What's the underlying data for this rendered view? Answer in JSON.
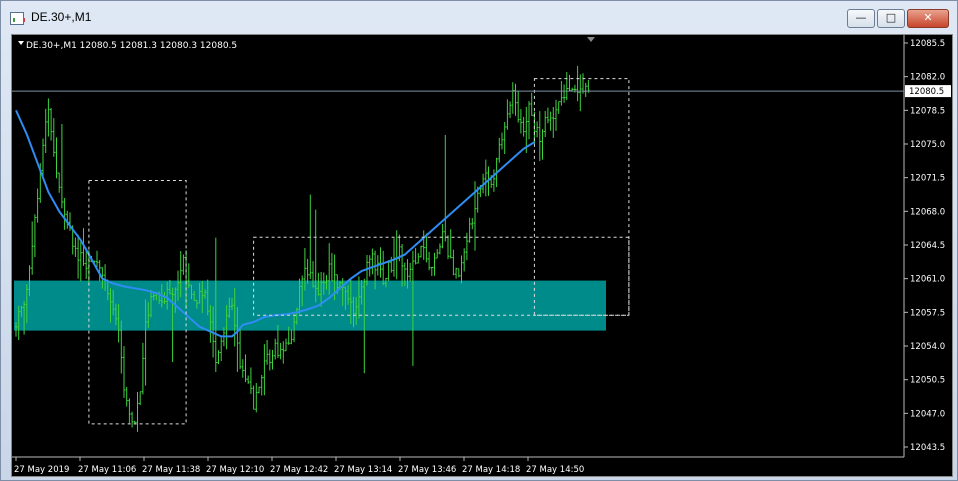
{
  "window": {
    "title": "DE.30+,M1",
    "minimize_glyph": "—",
    "maximize_glyph": "□",
    "close_glyph": "✕"
  },
  "chart_data": {
    "type": "candlestick",
    "symbol_header": "DE.30+,M1  12080.5 12081.3 12080.3 12080.5",
    "last_price_label": "12080.5",
    "last_price": 12080.5,
    "y_ticks": [
      "12085.5",
      "12082.0",
      "12078.5",
      "12075.0",
      "12071.5",
      "12068.0",
      "12064.5",
      "12061.0",
      "12057.5",
      "12054.0",
      "12050.5",
      "12047.0",
      "12043.5"
    ],
    "ylim": [
      12043.5,
      12085.5
    ],
    "x_ticks": [
      "27 May 2019",
      "27 May 11:06",
      "27 May 11:38",
      "27 May 12:10",
      "27 May 12:42",
      "27 May 13:14",
      "27 May 13:46",
      "27 May 14:18",
      "27 May 14:50"
    ],
    "bar_color": "#3fd23f",
    "ma_color": "#2f8cf2",
    "zone_color": "#008b8b",
    "zone": {
      "top": 12060.8,
      "bottom": 12055.6
    },
    "close_path": [
      [
        0,
        12056
      ],
      [
        4,
        12060
      ],
      [
        8,
        12070
      ],
      [
        12,
        12079
      ],
      [
        14,
        12074
      ],
      [
        18,
        12068
      ],
      [
        22,
        12064
      ],
      [
        26,
        12062
      ],
      [
        30,
        12063
      ],
      [
        34,
        12060
      ],
      [
        36,
        12058
      ],
      [
        38,
        12055
      ],
      [
        40,
        12050
      ],
      [
        42,
        12047
      ],
      [
        44,
        12046
      ],
      [
        46,
        12050
      ],
      [
        48,
        12056
      ],
      [
        50,
        12059
      ],
      [
        52,
        12060
      ],
      [
        54,
        12058
      ],
      [
        56,
        12060
      ],
      [
        58,
        12059
      ],
      [
        60,
        12061
      ],
      [
        62,
        12063
      ],
      [
        64,
        12060
      ],
      [
        66,
        12058
      ],
      [
        68,
        12059
      ],
      [
        70,
        12060
      ],
      [
        72,
        12056
      ],
      [
        74,
        12052
      ],
      [
        76,
        12055
      ],
      [
        78,
        12057
      ],
      [
        80,
        12058
      ],
      [
        82,
        12054
      ],
      [
        84,
        12051
      ],
      [
        86,
        12050
      ],
      [
        88,
        12048
      ],
      [
        90,
        12049
      ],
      [
        92,
        12052
      ],
      [
        94,
        12053
      ],
      [
        96,
        12054
      ],
      [
        98,
        12053
      ],
      [
        100,
        12055
      ],
      [
        102,
        12055
      ],
      [
        104,
        12058
      ],
      [
        106,
        12061
      ],
      [
        108,
        12062
      ],
      [
        110,
        12060
      ],
      [
        112,
        12059
      ],
      [
        114,
        12061
      ],
      [
        116,
        12062
      ],
      [
        118,
        12061
      ],
      [
        120,
        12060
      ],
      [
        122,
        12059
      ],
      [
        124,
        12058
      ],
      [
        126,
        12058
      ],
      [
        128,
        12060
      ],
      [
        130,
        12062
      ],
      [
        132,
        12063
      ],
      [
        134,
        12062
      ],
      [
        136,
        12061
      ],
      [
        138,
        12062
      ],
      [
        140,
        12063
      ],
      [
        142,
        12064
      ],
      [
        144,
        12062
      ],
      [
        146,
        12062
      ],
      [
        148,
        12063
      ],
      [
        150,
        12064
      ],
      [
        152,
        12063
      ],
      [
        154,
        12062
      ],
      [
        156,
        12064
      ],
      [
        158,
        12066
      ],
      [
        160,
        12064
      ],
      [
        162,
        12061
      ],
      [
        164,
        12062
      ],
      [
        166,
        12064
      ],
      [
        168,
        12066
      ],
      [
        170,
        12069
      ],
      [
        172,
        12071
      ],
      [
        174,
        12072
      ],
      [
        176,
        12071
      ],
      [
        178,
        12073
      ],
      [
        180,
        12076
      ],
      [
        182,
        12078
      ],
      [
        184,
        12080
      ],
      [
        186,
        12078
      ],
      [
        188,
        12077
      ],
      [
        190,
        12079
      ],
      [
        192,
        12077
      ],
      [
        194,
        12076
      ],
      [
        196,
        12078
      ],
      [
        198,
        12077
      ],
      [
        200,
        12078
      ],
      [
        202,
        12080
      ],
      [
        204,
        12081
      ],
      [
        206,
        12080
      ],
      [
        208,
        12081
      ],
      [
        210,
        12080.5
      ],
      [
        212,
        12080.5
      ]
    ],
    "ma_path": [
      [
        0,
        12078.5
      ],
      [
        4,
        12076
      ],
      [
        8,
        12073
      ],
      [
        12,
        12070
      ],
      [
        16,
        12068
      ],
      [
        20,
        12066.5
      ],
      [
        24,
        12065
      ],
      [
        28,
        12063
      ],
      [
        32,
        12061
      ],
      [
        36,
        12060.5
      ],
      [
        40,
        12060.2
      ],
      [
        44,
        12060
      ],
      [
        48,
        12059.8
      ],
      [
        52,
        12059.5
      ],
      [
        56,
        12059
      ],
      [
        60,
        12058
      ],
      [
        64,
        12057
      ],
      [
        68,
        12056
      ],
      [
        72,
        12055.5
      ],
      [
        76,
        12055
      ],
      [
        80,
        12055
      ],
      [
        82,
        12055.5
      ],
      [
        84,
        12056.2
      ],
      [
        88,
        12056.5
      ],
      [
        92,
        12057
      ],
      [
        96,
        12057.2
      ],
      [
        100,
        12057.3
      ],
      [
        104,
        12057.5
      ],
      [
        108,
        12057.8
      ],
      [
        112,
        12058.2
      ],
      [
        116,
        12059
      ],
      [
        120,
        12060
      ],
      [
        124,
        12061
      ],
      [
        128,
        12061.8
      ],
      [
        132,
        12062.2
      ],
      [
        136,
        12062.6
      ],
      [
        140,
        12063
      ],
      [
        144,
        12063.5
      ],
      [
        148,
        12064.5
      ],
      [
        152,
        12065.5
      ],
      [
        156,
        12066.5
      ],
      [
        160,
        12067.5
      ],
      [
        164,
        12068.5
      ],
      [
        168,
        12069.5
      ],
      [
        172,
        12070.5
      ],
      [
        176,
        12071.5
      ],
      [
        180,
        12072.5
      ],
      [
        184,
        12073.5
      ],
      [
        188,
        12074.5
      ],
      [
        192,
        12075.2
      ]
    ],
    "total_bars": 216
  }
}
